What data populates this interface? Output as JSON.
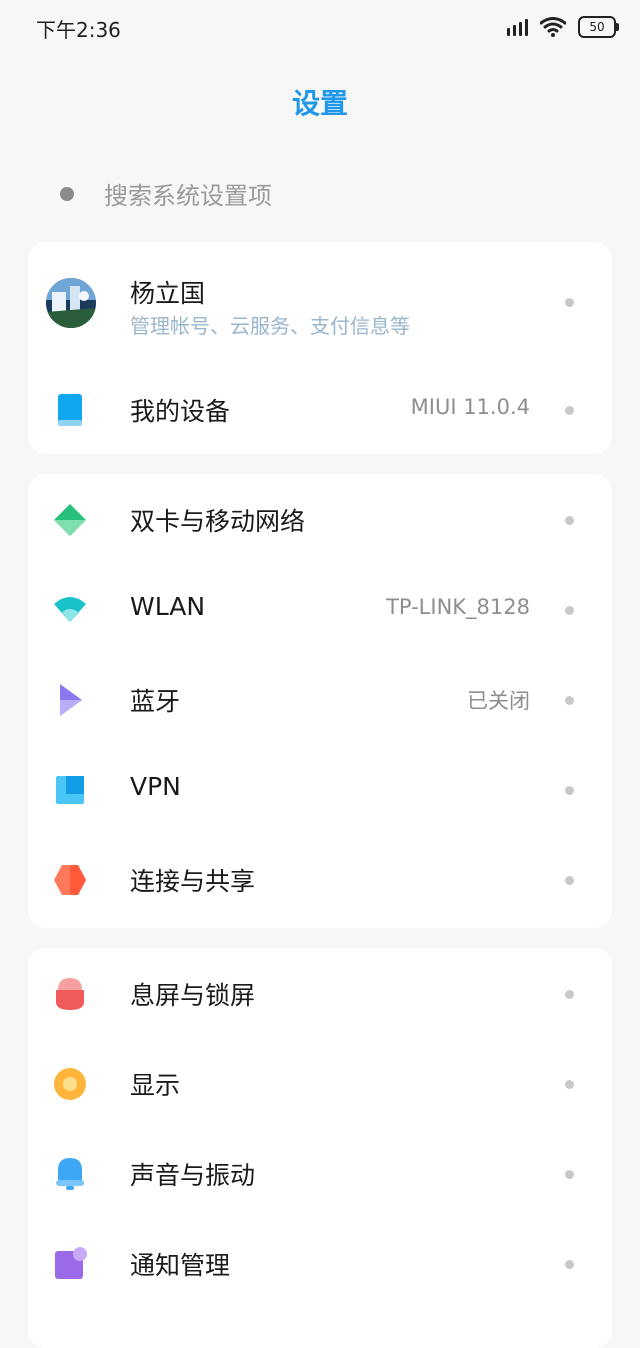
{
  "status": {
    "time": "下午2:36",
    "battery": "50"
  },
  "title": "设置",
  "search": {
    "placeholder": "搜索系统设置项"
  },
  "account": {
    "name": "杨立国",
    "subtitle": "管理帐号、云服务、支付信息等"
  },
  "device": {
    "label": "我的设备",
    "value": "MIUI 11.0.4"
  },
  "network": [
    {
      "label": "双卡与移动网络",
      "value": "",
      "icon": "sim-card-icon"
    },
    {
      "label": "WLAN",
      "value": "TP-LINK_8128",
      "icon": "wifi-icon"
    },
    {
      "label": "蓝牙",
      "value": "已关闭",
      "icon": "bluetooth-icon"
    },
    {
      "label": "VPN",
      "value": "",
      "icon": "vpn-icon"
    },
    {
      "label": "连接与共享",
      "value": "",
      "icon": "share-icon"
    }
  ],
  "system": [
    {
      "label": "息屏与锁屏",
      "icon": "lock-icon"
    },
    {
      "label": "显示",
      "icon": "display-icon"
    },
    {
      "label": "声音与振动",
      "icon": "bell-icon"
    },
    {
      "label": "通知管理",
      "icon": "notification-icon"
    }
  ],
  "colors": {
    "accent": "#1f98ea"
  }
}
